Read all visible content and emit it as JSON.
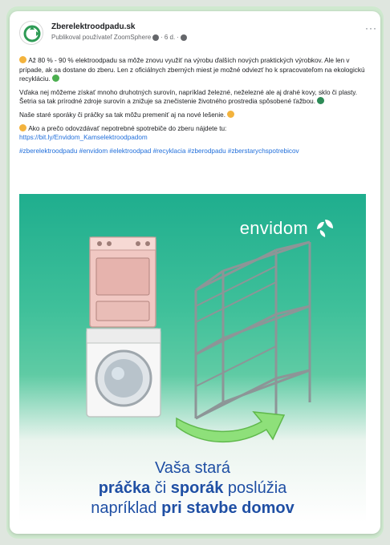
{
  "post": {
    "page_name": "Zberelektroodpadu.sk",
    "meta": "Publikoval používateľ ZoomSphere",
    "meta_time": "6 d.",
    "more_label": "···"
  },
  "text": {
    "p1": "Až 80 % - 90 % elektroodpadu sa môže znovu využiť na výrobu ďalších nových praktických výrobkov. Ale len v prípade, ak sa dostane do zberu. Len z oficiálnych zberných miest je možné odviezť ho k spracovateľom na ekologickú recykláciu.",
    "p2": "Vďaka nej môžeme získať mnoho druhotných surovín, napríklad železné, neželezné ale aj drahé kovy, sklo či plasty. Šetria sa tak prírodné zdroje surovín a znižuje sa znečistenie životného prostredia spôsobené ťažbou.",
    "p3": "Naše staré sporáky či práčky sa tak môžu premeniť aj na nové lešenie.",
    "p4": "Ako a prečo odovzdávať nepotrebné spotrebiče do zberu nájdete tu:",
    "link": "https://bit.ly/Envidom_Kamselektroodpadom",
    "hashtags": "#zberelektroodpadu #envidom #elektroodpad #recyklacia #zberodpadu #zberstarychspotrebicov"
  },
  "media": {
    "brand": "envidom",
    "caption_line1": "Vaša stará",
    "caption_w1": "práčka",
    "caption_w2": " či ",
    "caption_w3": "sporák",
    "caption_w4": " poslúžia",
    "caption_w5": "napríklad ",
    "caption_w6": "pri stavbe domov"
  },
  "colors": {
    "background": "#dfe6df",
    "accent_green": "#1fae8e",
    "caption_blue": "#1f4fa4",
    "link_blue": "#216fdb"
  }
}
